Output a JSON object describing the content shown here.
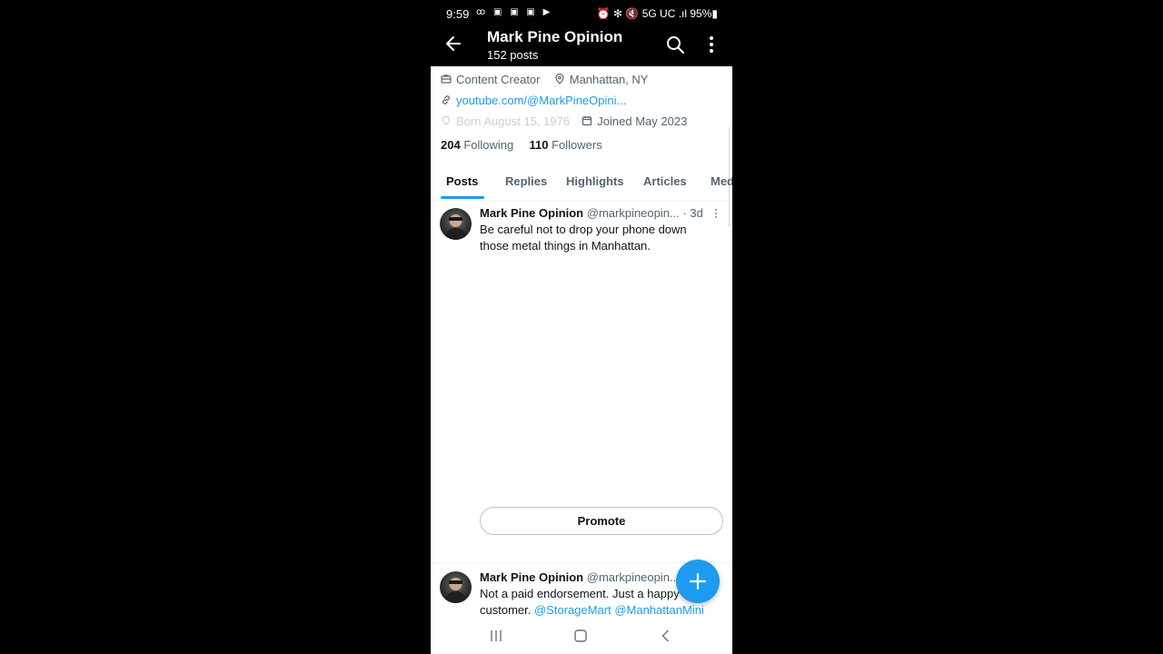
{
  "status_bar": {
    "time": "9:59",
    "left_icons": "ꝏ ▣ ▣ ▣ ▶",
    "right": "⏰ ✻ 🔇 5G UC .ıl 95%▮",
    "network": "5G UC",
    "battery": "95%"
  },
  "header": {
    "title": "Mark Pine Opinion",
    "subtitle": "152 posts",
    "back_icon": "arrow-left-icon",
    "search_icon": "search-icon",
    "more_icon": "more-vertical-icon"
  },
  "profile": {
    "category": "Content Creator",
    "location": "Manhattan, NY",
    "website": "youtube.com/@MarkPineOpini...",
    "born": "Born August 15, 1976",
    "joined": "Joined May 2023",
    "following_count": "204",
    "following_label": "Following",
    "followers_count": "110",
    "followers_label": "Followers"
  },
  "tabs": [
    {
      "label": "Posts",
      "active": true
    },
    {
      "label": "Replies",
      "active": false
    },
    {
      "label": "Highlights",
      "active": false
    },
    {
      "label": "Articles",
      "active": false
    },
    {
      "label": "Med",
      "active": false
    }
  ],
  "posts": [
    {
      "name": "Mark Pine Opinion",
      "handle": "@markpineopin...",
      "time": "· 3d",
      "text_line1": "Be careful not to drop your phone down",
      "text_line2": "those metal things in Manhattan.",
      "promote_label": "Promote"
    },
    {
      "name": "Mark Pine Opinion",
      "handle": "@markpineopin...",
      "text_line1": "Not a paid endorsement. Just a happy",
      "text_line2_plain": "customer.",
      "mention1": "@StorageMart",
      "mention2": "@ManhattanMini"
    }
  ],
  "colors": {
    "accent": "#1d9bf0",
    "text": "#0f1419",
    "secondary": "#536471"
  }
}
